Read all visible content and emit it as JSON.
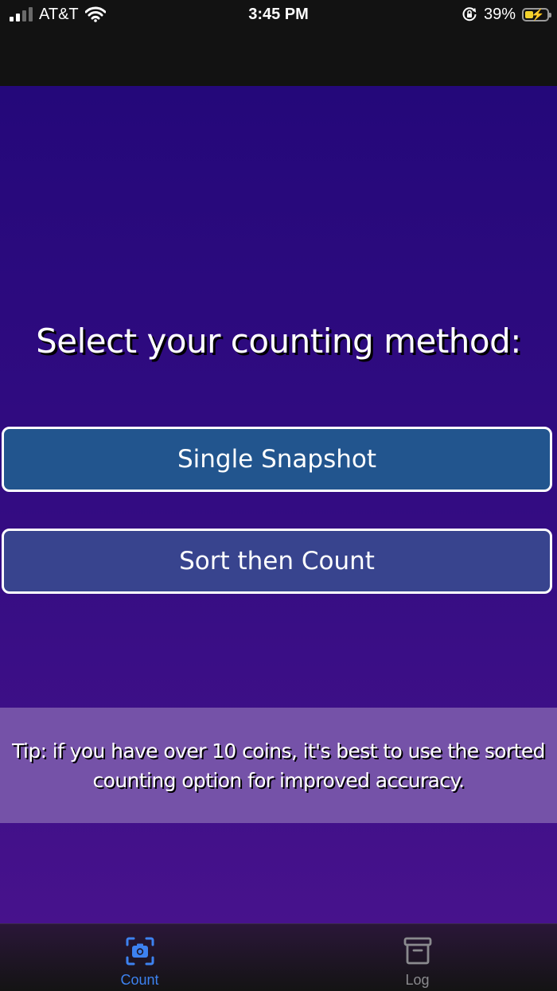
{
  "status_bar": {
    "carrier": "AT&T",
    "time": "3:45 PM",
    "battery_percent": "39%",
    "battery_level": 0.39,
    "icons": [
      "signal-icon",
      "wifi-icon",
      "orientation-lock-icon",
      "battery-charging-icon"
    ]
  },
  "main": {
    "heading": "Select your counting method:",
    "buttons": {
      "single": "Single Snapshot",
      "sort": "Sort then Count"
    },
    "tip": "Tip: if you have over 10 coins, it's best to use the sorted counting option for improved accuracy."
  },
  "tab_bar": {
    "tabs": [
      {
        "label": "Count",
        "icon": "camera-scan-icon",
        "active": true
      },
      {
        "label": "Log",
        "icon": "archive-box-icon",
        "active": false
      }
    ]
  },
  "colors": {
    "accent_active_tab": "#3d82f0",
    "inactive_tab": "#8a8a8e",
    "single_button": "#22558e",
    "sort_button": "#38448e",
    "tip_background": "#7552a8",
    "background_top": "#24087a",
    "background_bottom": "#47128c"
  }
}
